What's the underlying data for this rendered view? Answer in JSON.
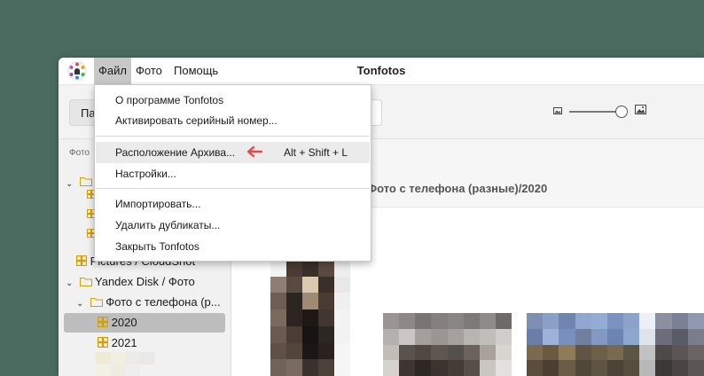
{
  "window": {
    "title": "Tonfotos",
    "menus": [
      "Файл",
      "Фото",
      "Помощь"
    ]
  },
  "toolbar": {
    "button_label": "Па",
    "zoom_small_icon": "image-small-icon",
    "zoom_large_icon": "image-large-icon",
    "zoom_level": 0.95
  },
  "file_menu": {
    "items": [
      "О программе Tonfotos",
      "Активировать серийный номер...",
      "Расположение Архива...",
      "Настройки...",
      "Импортировать...",
      "Удалить дубликаты...",
      "Закрыть Tonfotos"
    ],
    "archive_shortcut": "Alt + Shift + L",
    "arrow_color": "#e8474b"
  },
  "sidebar": {
    "section": "Фото",
    "items": [
      "Pictures / CloudShot",
      "Yandex Disk / Фото",
      "Фото с телефона (р...",
      "2020",
      "2021"
    ]
  },
  "main": {
    "path": "Фото с телефона (разные)/2020"
  },
  "colors": {
    "background": "#4b6b61",
    "folder": "#d4a000",
    "selection": "#bdbdbd"
  }
}
